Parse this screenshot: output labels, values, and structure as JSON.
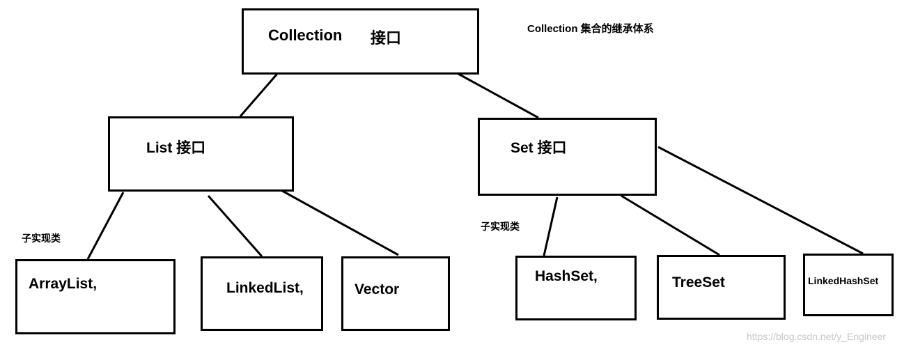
{
  "title_note": "Collection 集合的继承体系",
  "root": {
    "name": "Collection",
    "suffix": "接口"
  },
  "list": {
    "label": "List 接口"
  },
  "set": {
    "label": "Set 接口"
  },
  "subclass_note_left": "子实现类",
  "subclass_note_right": "子实现类",
  "list_children": [
    "ArrayList,",
    "LinkedList,",
    "Vector"
  ],
  "set_children": [
    "HashSet,",
    "TreeSet",
    "LinkedHashSet"
  ],
  "watermark": "https://blog.csdn.net/y_Engineer"
}
